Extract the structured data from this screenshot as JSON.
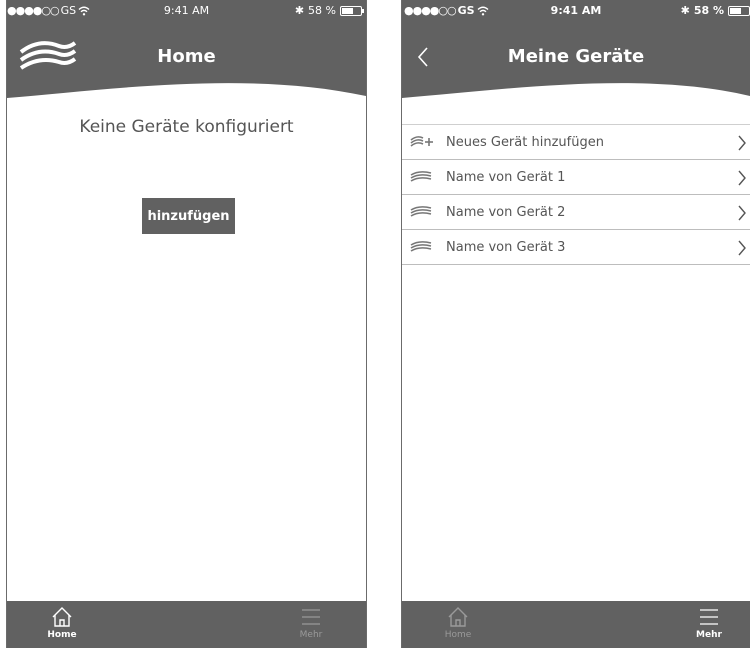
{
  "screens": [
    {
      "status_bar": {
        "carrier": "GS",
        "time": "9:41 AM",
        "battery": "58 %"
      },
      "header": {
        "title": "Home"
      },
      "main": {
        "empty_message": "Keine Geräte konfiguriert",
        "add_button_label": "hinzufügen"
      },
      "tabbar": {
        "home_label": "Home",
        "more_label": "Mehr",
        "active": "Home"
      }
    },
    {
      "status_bar": {
        "carrier": "GS",
        "time": "9:41 AM",
        "battery": "58 %"
      },
      "header": {
        "title": "Meine Geräte"
      },
      "device_list": [
        {
          "label": "Neues Gerät hinzufügen",
          "icon": "add-device-icon"
        },
        {
          "label": "Name von Gerät 1",
          "icon": "device-wave-icon"
        },
        {
          "label": "Name von Gerät 2",
          "icon": "device-wave-icon"
        },
        {
          "label": "Name von Gerät 3",
          "icon": "device-wave-icon"
        }
      ],
      "tabbar": {
        "home_label": "Home",
        "more_label": "Mehr",
        "active": "Mehr"
      }
    }
  ],
  "colors": {
    "header": "#616161",
    "text": "#555555",
    "divider": "#bdbdbd"
  }
}
